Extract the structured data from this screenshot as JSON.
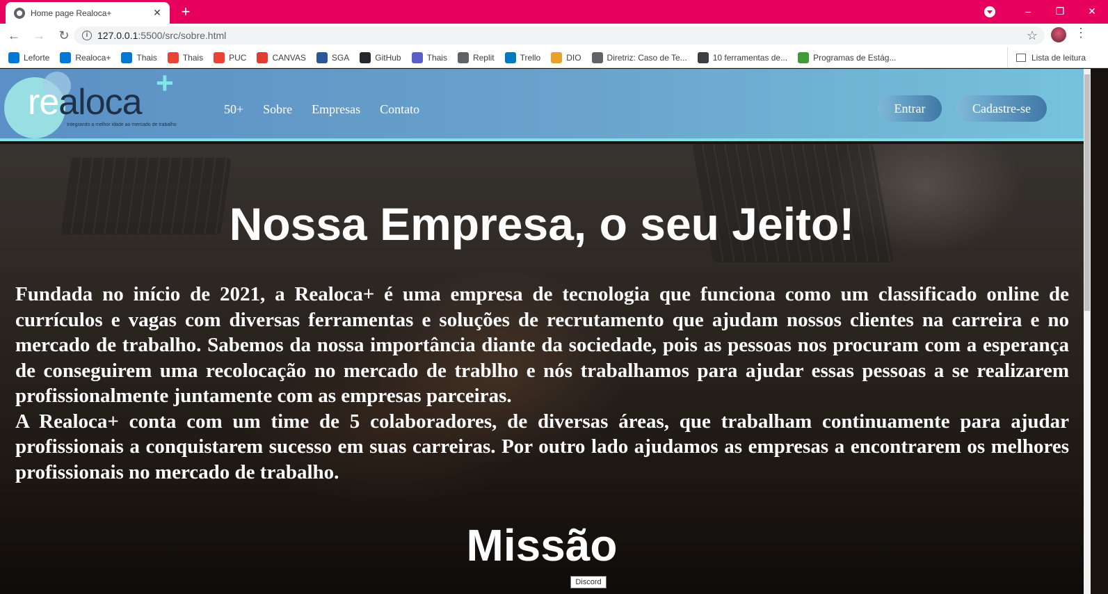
{
  "browser": {
    "tab": {
      "title": "Home page Realoca+",
      "close": "✕"
    },
    "new_tab": "+",
    "window_controls": {
      "minimize": "–",
      "restore": "❐",
      "close": "✕"
    },
    "url": {
      "host": "127.0.0.1",
      "path": ":5500/src/sobre.html"
    },
    "bookmarks": [
      {
        "label": "Leforte",
        "icon": "outlook-icon",
        "color": "#0078d4"
      },
      {
        "label": "Realoca+",
        "icon": "outlook-icon",
        "color": "#0078d4"
      },
      {
        "label": "Thais",
        "icon": "outlook-icon",
        "color": "#0078d4"
      },
      {
        "label": "Thais",
        "icon": "gmail-icon",
        "color": "#ea4335"
      },
      {
        "label": "PUC",
        "icon": "gmail-icon",
        "color": "#ea4335"
      },
      {
        "label": "CANVAS",
        "icon": "canvas-icon",
        "color": "#e13c2f"
      },
      {
        "label": "SGA",
        "icon": "sga-icon",
        "color": "#2b5797"
      },
      {
        "label": "GitHub",
        "icon": "github-icon",
        "color": "#24292e"
      },
      {
        "label": "Thais",
        "icon": "teams-icon",
        "color": "#5b5fc7"
      },
      {
        "label": "Replit",
        "icon": "replit-icon",
        "color": "#5f6368"
      },
      {
        "label": "Trello",
        "icon": "trello-icon",
        "color": "#0079bf"
      },
      {
        "label": "DIO",
        "icon": "dio-icon",
        "color": "#e8a12b"
      },
      {
        "label": "Diretriz: Caso de Te...",
        "icon": "globe-icon",
        "color": "#5f6368"
      },
      {
        "label": "10 ferramentas de...",
        "icon": "tools-icon",
        "color": "#3c4043"
      },
      {
        "label": "Programas de Estág...",
        "icon": "leaf-icon",
        "color": "#3f9b35"
      }
    ],
    "reading_list": "Lista de leitura"
  },
  "site": {
    "logo": {
      "re": "re",
      "aloca": "aloca",
      "plus": "+",
      "tagline": "Integrando a melhor idade ao mercado de trabalho"
    },
    "nav": [
      "50+",
      "Sobre",
      "Empresas",
      "Contato"
    ],
    "login_button": "Entrar",
    "signup_button": "Cadastre-se"
  },
  "hero": {
    "title": "Nossa Empresa, o seu Jeito!",
    "paragraphs": [
      "Fundada no início de 2021, a Realoca+ é uma empresa de tecnologia que funciona como um classificado online de currículos e vagas com diversas ferramentas e soluções de recrutamento que ajudam nossos clientes na carreira e no mercado de trabalho. Sabemos da nossa importância diante da sociedade, pois as pessoas nos procuram com a esperança de conseguirem uma recolocação no mercado de trablho e nós trabalhamos para ajudar essas pessoas a se realizarem profissionalmente juntamente com as empresas parceiras.",
      "A Realoca+ conta com um time de 5 colaboradores, de diversas áreas, que trabalham continuamente para ajudar profissionais a conquistarem sucesso em suas carreiras. Por outro lado ajudamos as empresas a encontrarem os melhores profissionais no mercado de trabalho."
    ],
    "section_title": "Missão"
  },
  "tooltip": "Discord"
}
